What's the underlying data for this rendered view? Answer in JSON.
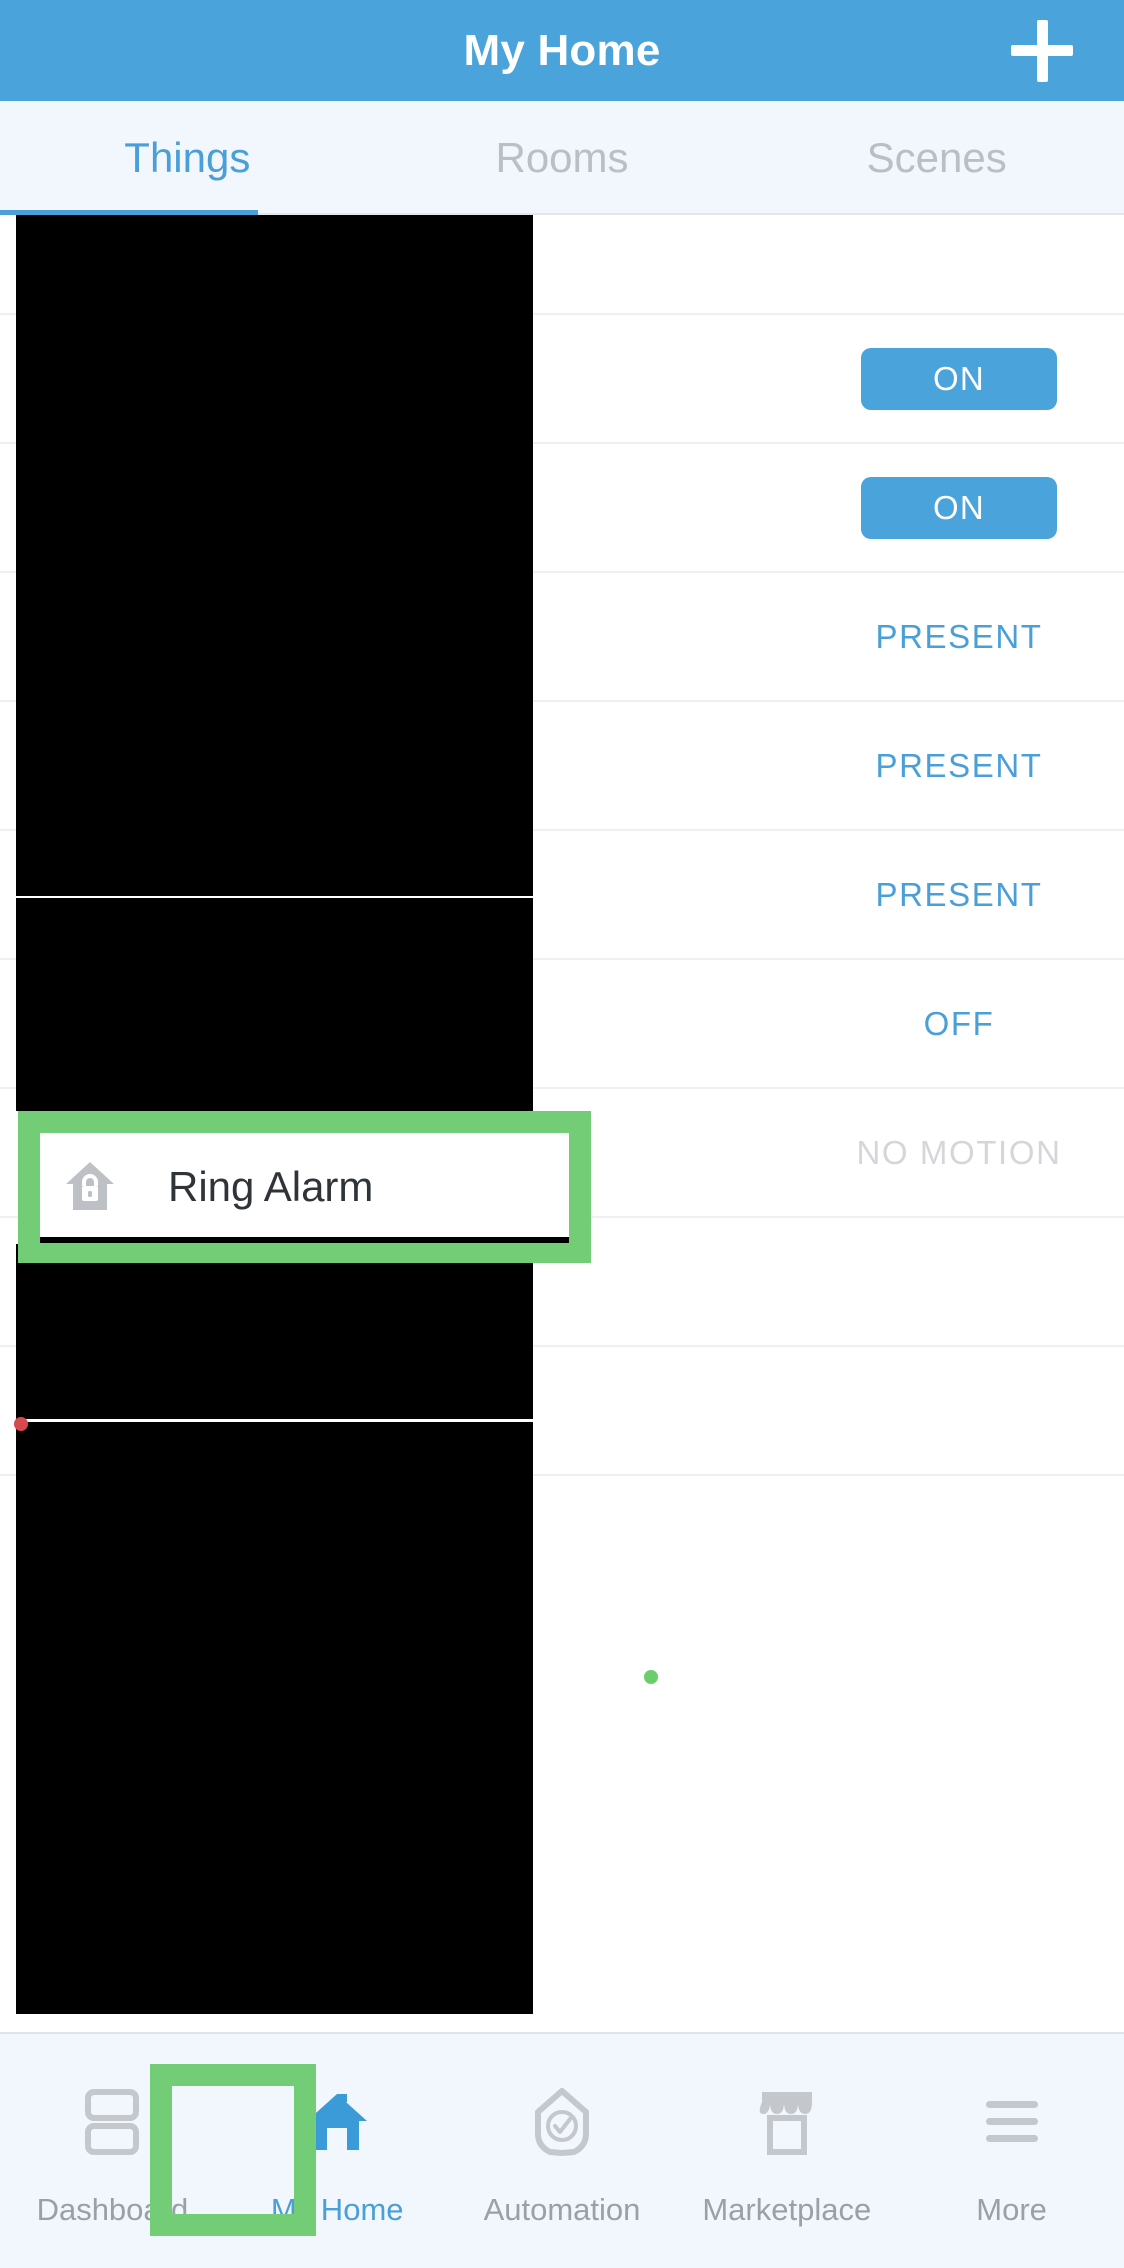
{
  "header": {
    "title": "My Home",
    "add_icon": "plus-icon"
  },
  "tabs": [
    {
      "label": "Things",
      "active": true
    },
    {
      "label": "Rooms",
      "active": false
    },
    {
      "label": "Scenes",
      "active": false
    }
  ],
  "things": [
    {
      "name": "",
      "status": "",
      "status_style": "none",
      "icon": ""
    },
    {
      "name": "",
      "status": "ON",
      "status_style": "button",
      "icon": ""
    },
    {
      "name": "",
      "status": "ON",
      "status_style": "button",
      "icon": ""
    },
    {
      "name": "",
      "status": "PRESENT",
      "status_style": "blue-text",
      "icon": ""
    },
    {
      "name": "",
      "status": "PRESENT",
      "status_style": "blue-text",
      "icon": ""
    },
    {
      "name": "",
      "status": "PRESENT",
      "status_style": "blue-text",
      "icon": ""
    },
    {
      "name": "Ring Alarm",
      "status": "OFF",
      "status_style": "blue-text",
      "icon": "home-lock-icon"
    },
    {
      "name": "",
      "status": "NO MOTION",
      "status_style": "grey-text",
      "icon": ""
    },
    {
      "name": "",
      "status": "",
      "status_style": "none",
      "icon": ""
    },
    {
      "name": "",
      "status": "",
      "status_style": "none",
      "icon": ""
    }
  ],
  "indicators": {
    "red_dot_color": "#d8494f",
    "green_dot_color": "#6ace6d"
  },
  "highlight": {
    "color": "#72cd76"
  },
  "bottom_nav": [
    {
      "label": "Dashboard",
      "icon": "dashboard-icon",
      "active": false
    },
    {
      "label": "My Home",
      "icon": "home-icon",
      "active": true
    },
    {
      "label": "Automation",
      "icon": "shield-check-icon",
      "active": false
    },
    {
      "label": "Marketplace",
      "icon": "store-icon",
      "active": false
    },
    {
      "label": "More",
      "icon": "hamburger-icon",
      "active": false
    }
  ],
  "colors": {
    "accent": "#4aa3db",
    "tab_bg": "#f2f6fd",
    "muted": "#9aa0a6"
  }
}
